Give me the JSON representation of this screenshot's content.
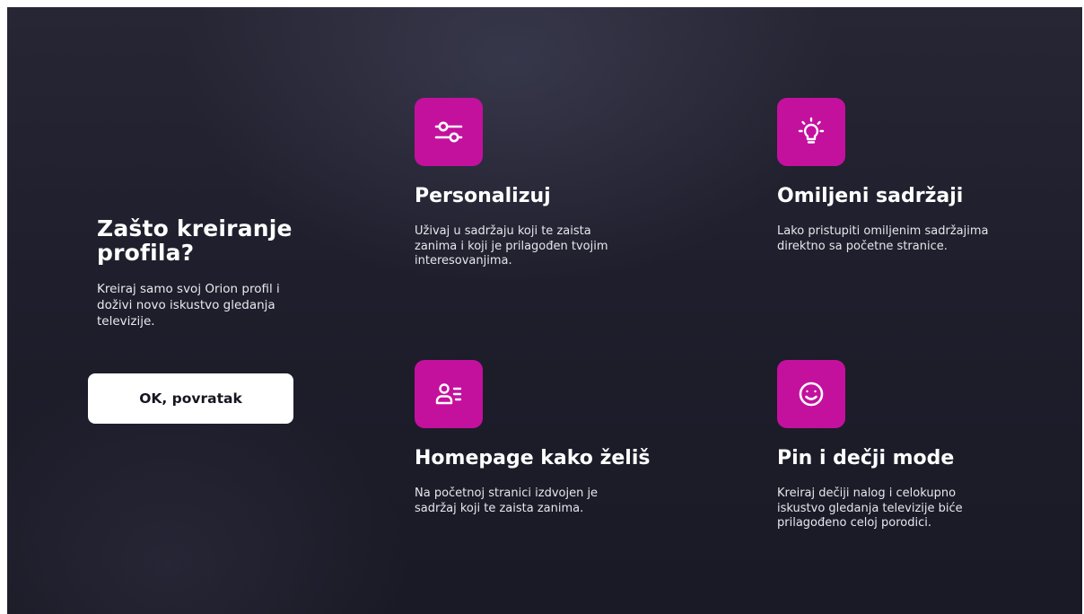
{
  "intro": {
    "title": "Zašto kreiranje\nprofila?",
    "description": "Kreiraj samo svoj Orion profil i\ndoživi novo iskustvo gledanja\ntelevizije."
  },
  "actions": {
    "ok_label": "OK, povratak"
  },
  "accent_color": "#c3119e",
  "features": [
    {
      "icon": "sliders-icon",
      "title": "Personalizuj",
      "text": "Uživaj u sadržaju koji te zaista\nzanima i koji je prilagođen tvojim\ninteresovanjima."
    },
    {
      "icon": "lightbulb-icon",
      "title": "Omiljeni sadržaji",
      "text": "Lako pristupiti omiljenim sadržajima\ndirektno sa početne stranice."
    },
    {
      "icon": "user-list-icon",
      "title": "Homepage kako želiš",
      "text": "Na početnoj stranici izdvojen je\nsadržaj koji te zaista zanima."
    },
    {
      "icon": "smiley-icon",
      "title": "Pin i dečji mode",
      "text": "Kreiraj dečiji nalog i celokupno\niskustvo gledanja televizije biće\nprilagođeno celoj porodici."
    }
  ]
}
